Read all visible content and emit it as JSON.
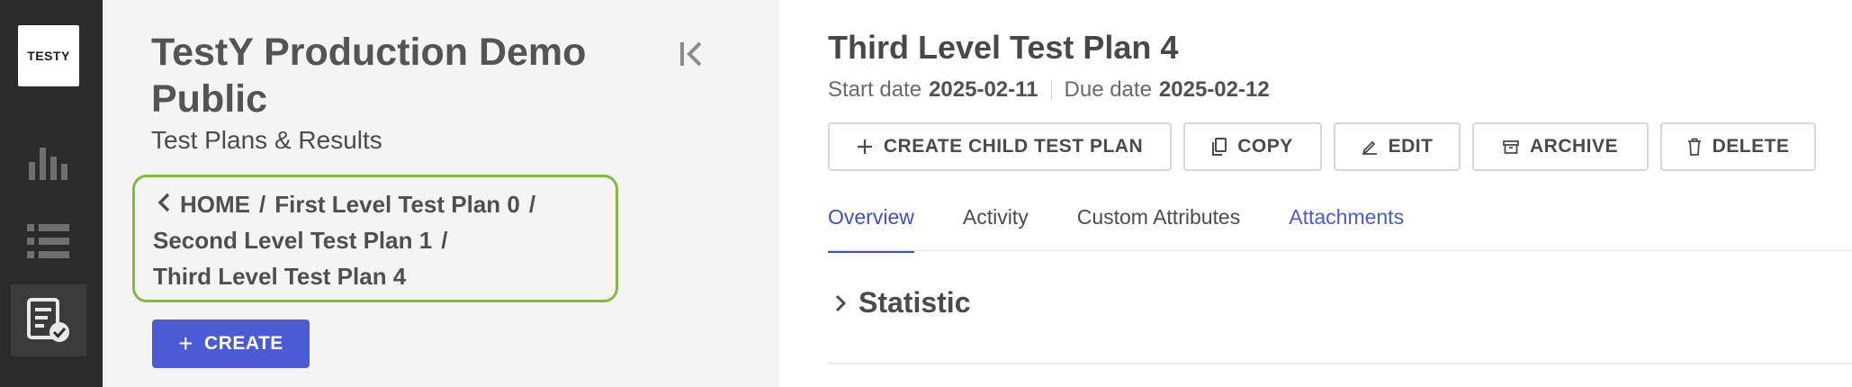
{
  "app": {
    "logo_text": "TESTY"
  },
  "rail": {
    "items": [
      {
        "icon": "bar-chart-icon"
      },
      {
        "icon": "list-icon"
      },
      {
        "icon": "test-plan-check-icon",
        "active": true
      }
    ]
  },
  "panel": {
    "project_title": "TestY Production Demo Public",
    "subtitle": "Test Plans & Results",
    "breadcrumb": {
      "home": "HOME",
      "separator": "/",
      "level1": "First Level Test Plan 0",
      "level2": "Second Level Test Plan 1",
      "level3": "Third Level Test Plan 4"
    },
    "create_label": "CREATE"
  },
  "plan": {
    "title": "Third Level Test Plan 4",
    "start_label": "Start date",
    "start_value": "2025-02-11",
    "due_label": "Due date",
    "due_value": "2025-02-12"
  },
  "toolbar": {
    "create_child": "CREATE CHILD TEST PLAN",
    "copy": "COPY",
    "edit": "EDIT",
    "archive": "ARCHIVE",
    "delete": "DELETE"
  },
  "tabs": [
    "Overview",
    "Activity",
    "Custom Attributes",
    "Attachments"
  ],
  "active_tab": "Overview",
  "section": {
    "title": "Statistic"
  },
  "colors": {
    "accent": "#4a5bd4",
    "breadcrumb_border": "#84b84a",
    "rail_bg": "#2b2b2b",
    "panel_bg": "#f4f4f5"
  }
}
